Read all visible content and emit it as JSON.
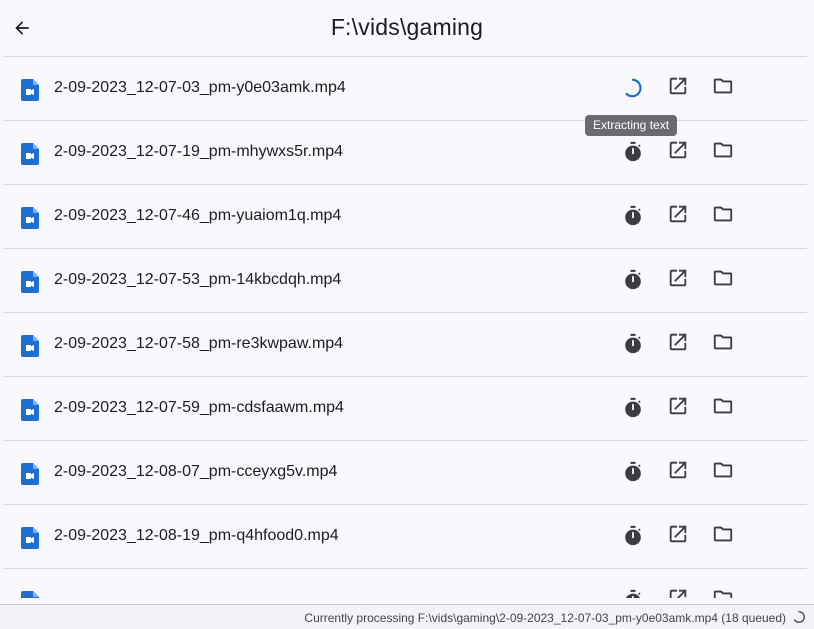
{
  "header": {
    "title": "F:\\vids\\gaming",
    "back_icon": "arrow-back-icon"
  },
  "files": [
    {
      "name": "2-09-2023_12-07-03_pm-y0e03amk.mp4",
      "status": "processing"
    },
    {
      "name": "2-09-2023_12-07-19_pm-mhywxs5r.mp4",
      "status": "queued"
    },
    {
      "name": "2-09-2023_12-07-46_pm-yuaiom1q.mp4",
      "status": "queued"
    },
    {
      "name": "2-09-2023_12-07-53_pm-14kbcdqh.mp4",
      "status": "queued"
    },
    {
      "name": "2-09-2023_12-07-58_pm-re3kwpaw.mp4",
      "status": "queued"
    },
    {
      "name": "2-09-2023_12-07-59_pm-cdsfaawm.mp4",
      "status": "queued"
    },
    {
      "name": "2-09-2023_12-08-07_pm-cceyxg5v.mp4",
      "status": "queued"
    },
    {
      "name": "2-09-2023_12-08-19_pm-q4hfood0.mp4",
      "status": "queued"
    }
  ],
  "tooltip": "Extracting text",
  "statusbar": {
    "text": "Currently processing F:\\vids\\gaming\\2-09-2023_12-07-03_pm-y0e03amk.mp4 (18 queued)"
  },
  "colors": {
    "accent": "#1e6fd0",
    "icon": "#3c3b40",
    "background": "#f9f8fd",
    "divider": "#d9d8de"
  }
}
